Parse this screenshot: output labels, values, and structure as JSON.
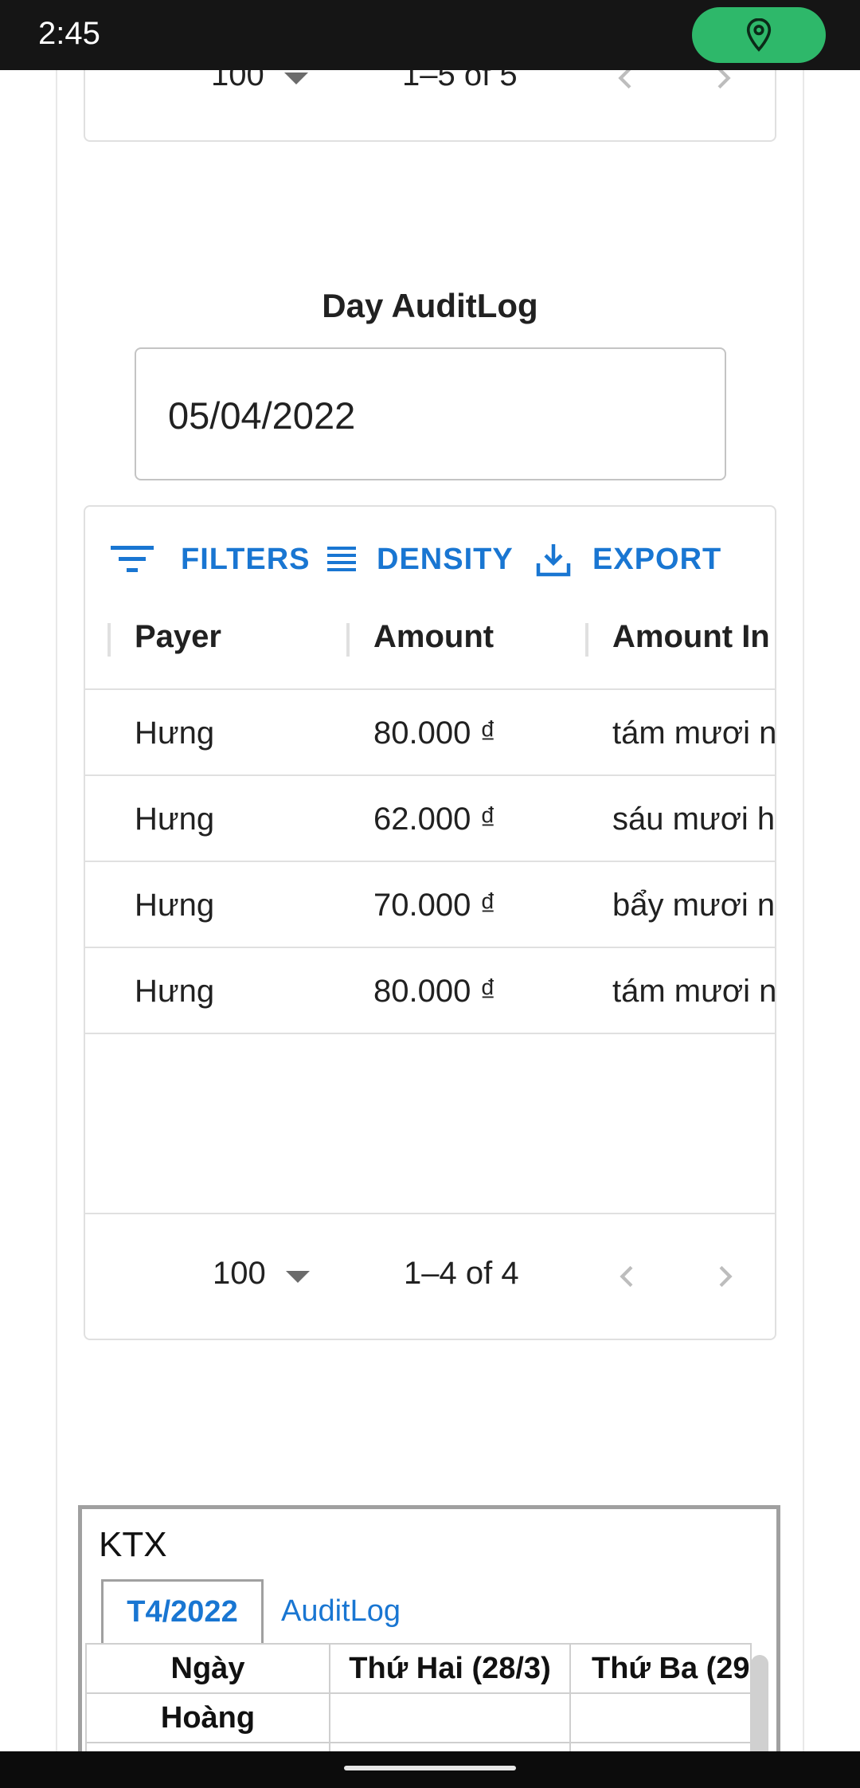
{
  "status_bar": {
    "time": "2:45",
    "location_icon": "location-pin-icon"
  },
  "previous_grid": {
    "rows_per_page": "100",
    "page_range": "1–5 of 5"
  },
  "day_auditlog": {
    "title": "Day AuditLog",
    "date_value": "05/04/2022"
  },
  "toolbar": {
    "filters_label": "FILTERS",
    "density_label": "DENSITY",
    "export_label": "EXPORT",
    "accent_color": "#1976d2"
  },
  "grid": {
    "columns": [
      "Payer",
      "Amount",
      "Amount In"
    ],
    "rows": [
      {
        "payer": "Hưng",
        "amount": "80.000 ₫",
        "amount_in": "tám mươi n"
      },
      {
        "payer": "Hưng",
        "amount": "62.000 ₫",
        "amount_in": "sáu mươi h"
      },
      {
        "payer": "Hưng",
        "amount": "70.000 ₫",
        "amount_in": "bẩy mươi n"
      },
      {
        "payer": "Hưng",
        "amount": "80.000 ₫",
        "amount_in": "tám mươi n"
      }
    ],
    "rows_per_page": "100",
    "page_range": "1–4 of 4"
  },
  "ktx": {
    "title": "KTX",
    "tabs": [
      "T4/2022",
      "AuditLog"
    ],
    "table_headers": [
      "Ngày",
      "Thứ Hai (28/3)",
      "Thứ Ba (29"
    ],
    "first_row_name": "Hoàng"
  }
}
